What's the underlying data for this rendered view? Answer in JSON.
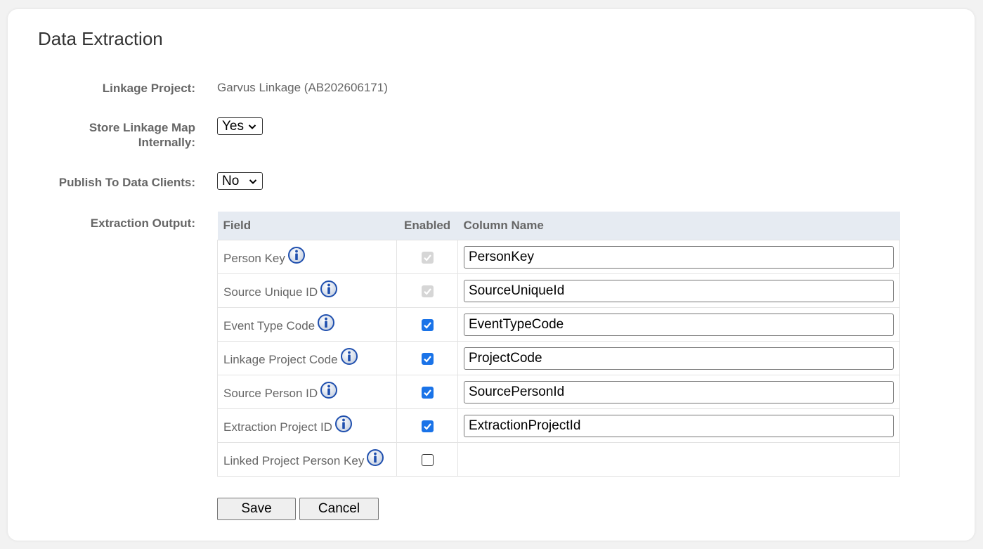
{
  "page": {
    "title": "Data Extraction"
  },
  "form": {
    "linkage_project_label": "Linkage Project:",
    "linkage_project_value": "Garvus Linkage (AB202606171)",
    "store_map_label_line1": "Store Linkage Map",
    "store_map_label_line2": "Internally:",
    "store_map_value": "Yes",
    "publish_label": "Publish To Data Clients:",
    "publish_value": "No",
    "extraction_output_label": "Extraction Output:"
  },
  "table": {
    "headers": {
      "field": "Field",
      "enabled": "Enabled",
      "column_name": "Column Name"
    },
    "rows": [
      {
        "field": "Person Key",
        "enabled": true,
        "disabled": true,
        "column_name": "PersonKey"
      },
      {
        "field": "Source Unique ID",
        "enabled": true,
        "disabled": true,
        "column_name": "SourceUniqueId"
      },
      {
        "field": "Event Type Code",
        "enabled": true,
        "disabled": false,
        "column_name": "EventTypeCode"
      },
      {
        "field": "Linkage Project Code",
        "enabled": true,
        "disabled": false,
        "column_name": "ProjectCode"
      },
      {
        "field": "Source Person ID",
        "enabled": true,
        "disabled": false,
        "column_name": "SourcePersonId"
      },
      {
        "field": "Extraction Project ID",
        "enabled": true,
        "disabled": false,
        "column_name": "ExtractionProjectId"
      },
      {
        "field": "Linked Project Person Key",
        "enabled": false,
        "disabled": false,
        "column_name": ""
      }
    ]
  },
  "buttons": {
    "save": "Save",
    "cancel": "Cancel"
  },
  "icons": {
    "info": "info-icon",
    "dropdown": "chevron-down-icon",
    "check": "checkmark-icon"
  },
  "colors": {
    "checkbox_accent": "#1a73e8",
    "header_bg": "#e6ebf2",
    "info_blue": "#1f4fae"
  }
}
